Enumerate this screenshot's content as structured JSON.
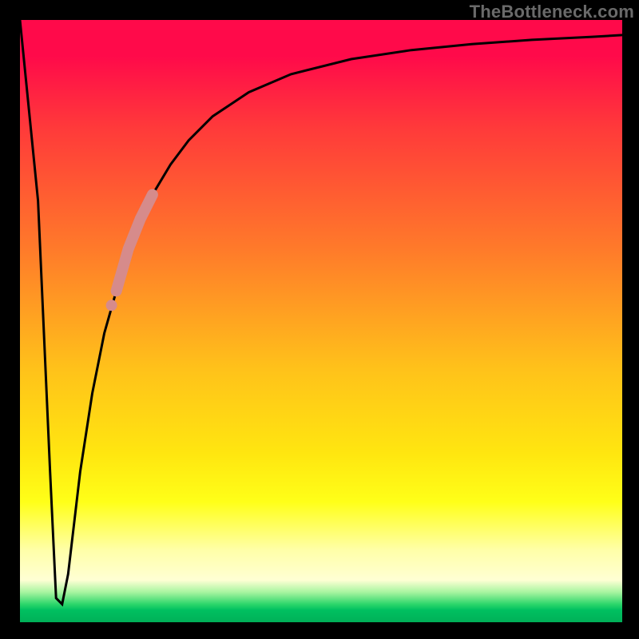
{
  "watermark": "TheBottleneck.com",
  "colors": {
    "frame": "#000000",
    "curve": "#000000",
    "highlight": "#d68b8b",
    "gradient_top": "#ff0a4a",
    "gradient_bottom": "#00b058"
  },
  "chart_data": {
    "type": "line",
    "title": "",
    "xlabel": "",
    "ylabel": "",
    "xlim": [
      0,
      100
    ],
    "ylim": [
      0,
      100
    ],
    "grid": false,
    "legend": false,
    "series": [
      {
        "name": "bottleneck-curve",
        "x": [
          0,
          3,
          5,
          6,
          7,
          8,
          10,
          12,
          14,
          16,
          18,
          20,
          22,
          25,
          28,
          32,
          38,
          45,
          55,
          65,
          75,
          85,
          95,
          100
        ],
        "y": [
          100,
          70,
          25,
          4,
          3,
          8,
          25,
          38,
          48,
          55,
          62,
          67,
          71,
          76,
          80,
          84,
          88,
          91,
          93.5,
          95,
          96,
          96.7,
          97.2,
          97.5
        ]
      }
    ],
    "highlight_segment": {
      "series": "bottleneck-curve",
      "x_start": 16,
      "x_end": 22,
      "note": "thicker pink overlay along curve"
    }
  }
}
